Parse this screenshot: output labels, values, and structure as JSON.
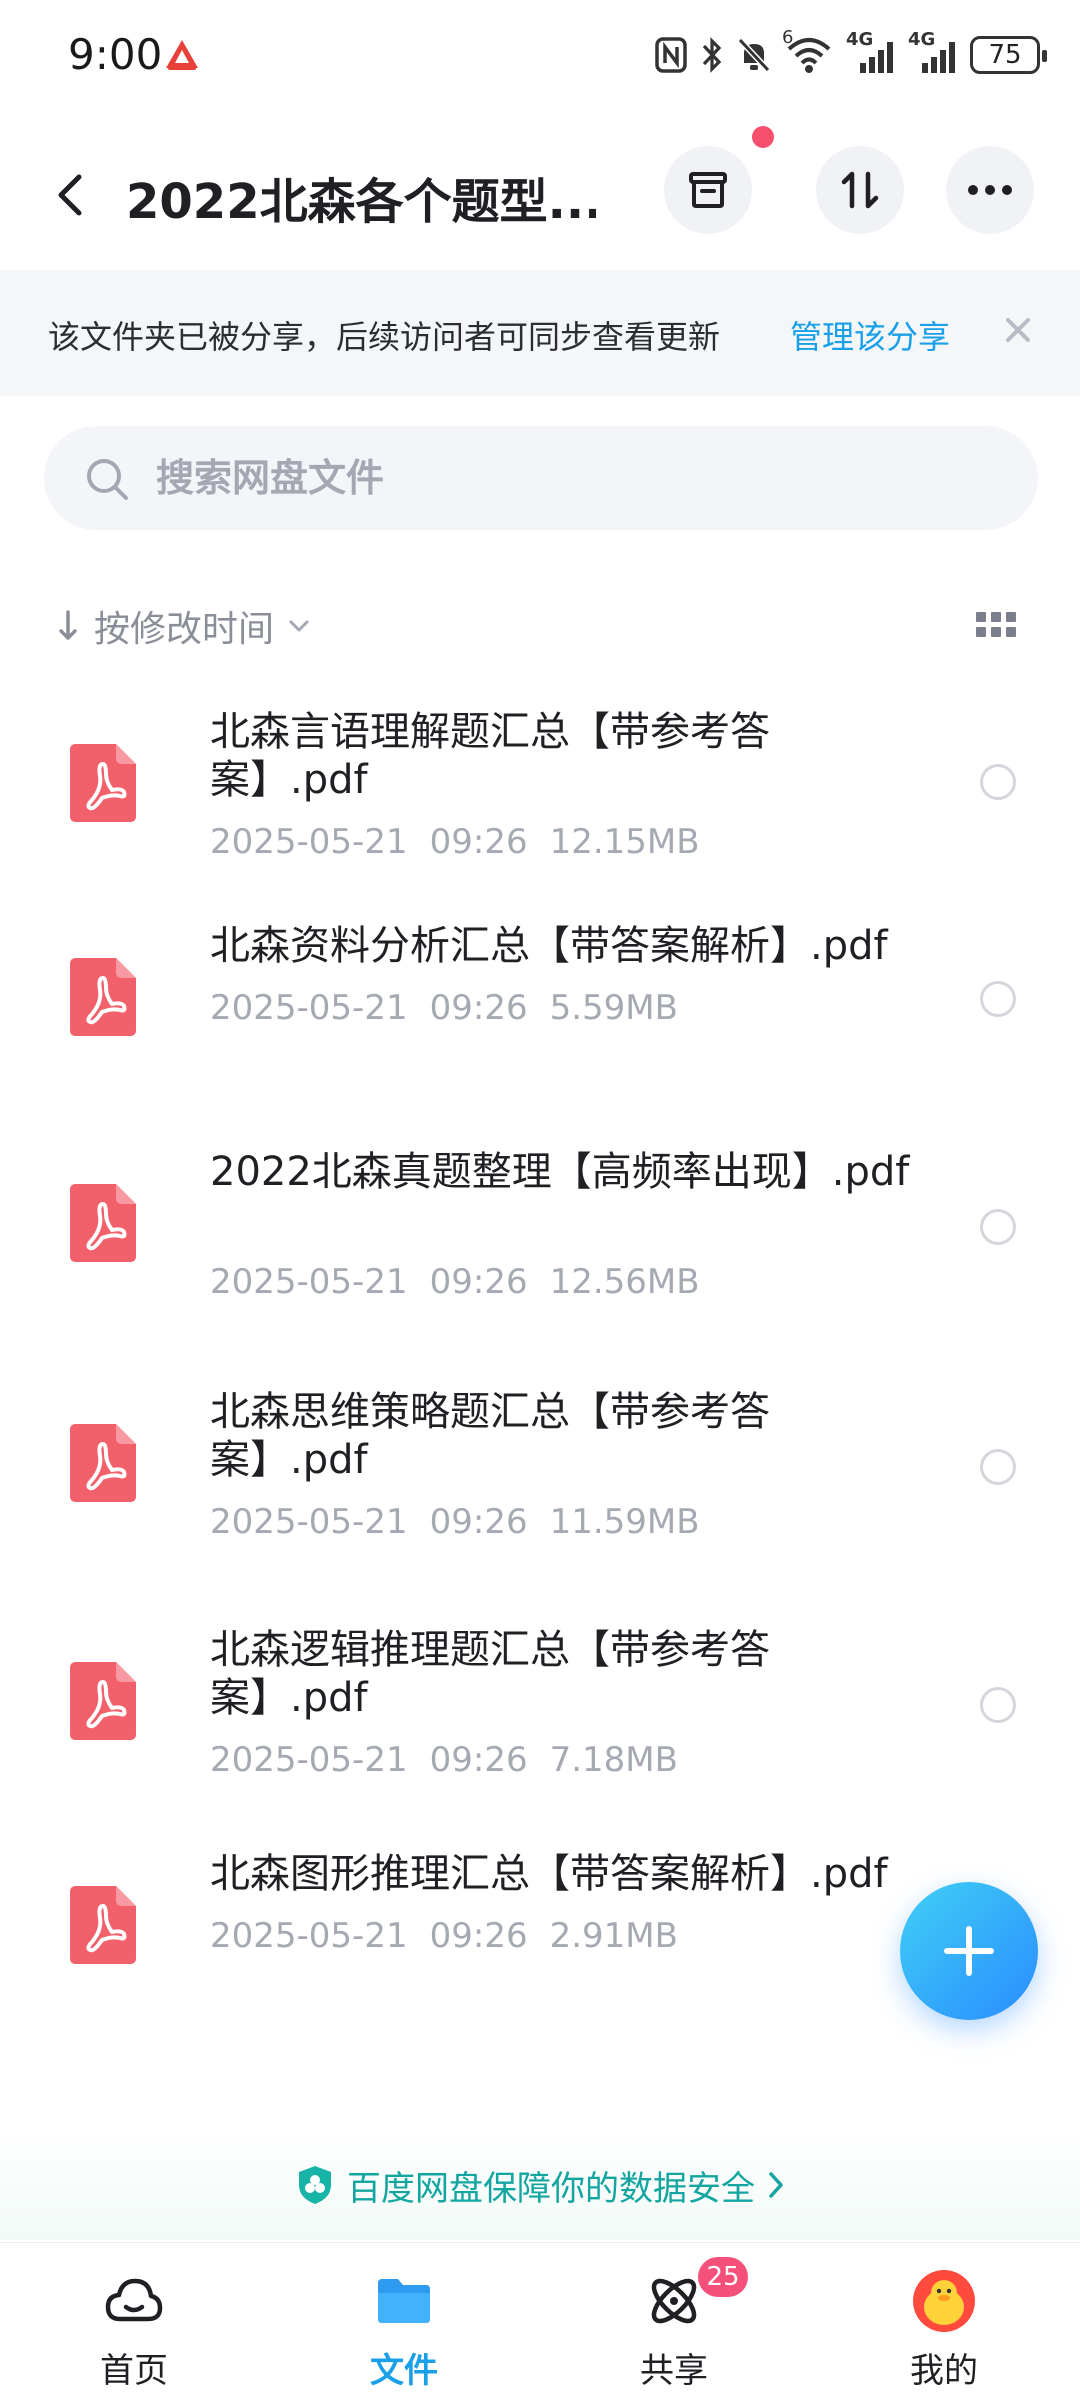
{
  "status_bar": {
    "time": "9:00",
    "battery": "75",
    "network_1": "4G",
    "network_2": "4G",
    "wifi_mark": "6"
  },
  "header": {
    "title": "2022北森各个题型...",
    "icons": [
      "back-chevron-icon",
      "archive-icon",
      "sort-transfer-icon",
      "more-icon"
    ]
  },
  "share_banner": {
    "text": "该文件夹已被分享，后续访问者可同步查看更新",
    "link": "管理该分享"
  },
  "search": {
    "placeholder": "搜索网盘文件",
    "value": ""
  },
  "sort": {
    "label": "按修改时间"
  },
  "files": [
    {
      "name": "北森言语理解题汇总【带参考答案】.pdf",
      "date": "2025-05-21",
      "time": "09:26",
      "size": "12.15MB"
    },
    {
      "name": "北森资料分析汇总【带答案解析】.pdf",
      "date": "2025-05-21",
      "time": "09:26",
      "size": "5.59MB"
    },
    {
      "name": "2022北森真题整理【高频率出现】.pdf",
      "date": "2025-05-21",
      "time": "09:26",
      "size": "12.56MB"
    },
    {
      "name": "北森思维策略题汇总【带参考答案】.pdf",
      "date": "2025-05-21",
      "time": "09:26",
      "size": "11.59MB"
    },
    {
      "name": "北森逻辑推理题汇总【带参考答案】.pdf",
      "date": "2025-05-21",
      "time": "09:26",
      "size": "7.18MB"
    },
    {
      "name": "北森图形推理汇总【带答案解析】.pdf",
      "date": "2025-05-21",
      "time": "09:26",
      "size": "2.91MB"
    }
  ],
  "security": {
    "text": "百度网盘保障你的数据安全"
  },
  "bottom_nav": {
    "home": "首页",
    "files": "文件",
    "share": "共享",
    "share_badge": "25",
    "mine": "我的"
  },
  "colors": {
    "accent": "#1aa0e8",
    "pdf_red": "#f2606b",
    "badge": "#f5507a",
    "security_green": "#13a5a0"
  }
}
